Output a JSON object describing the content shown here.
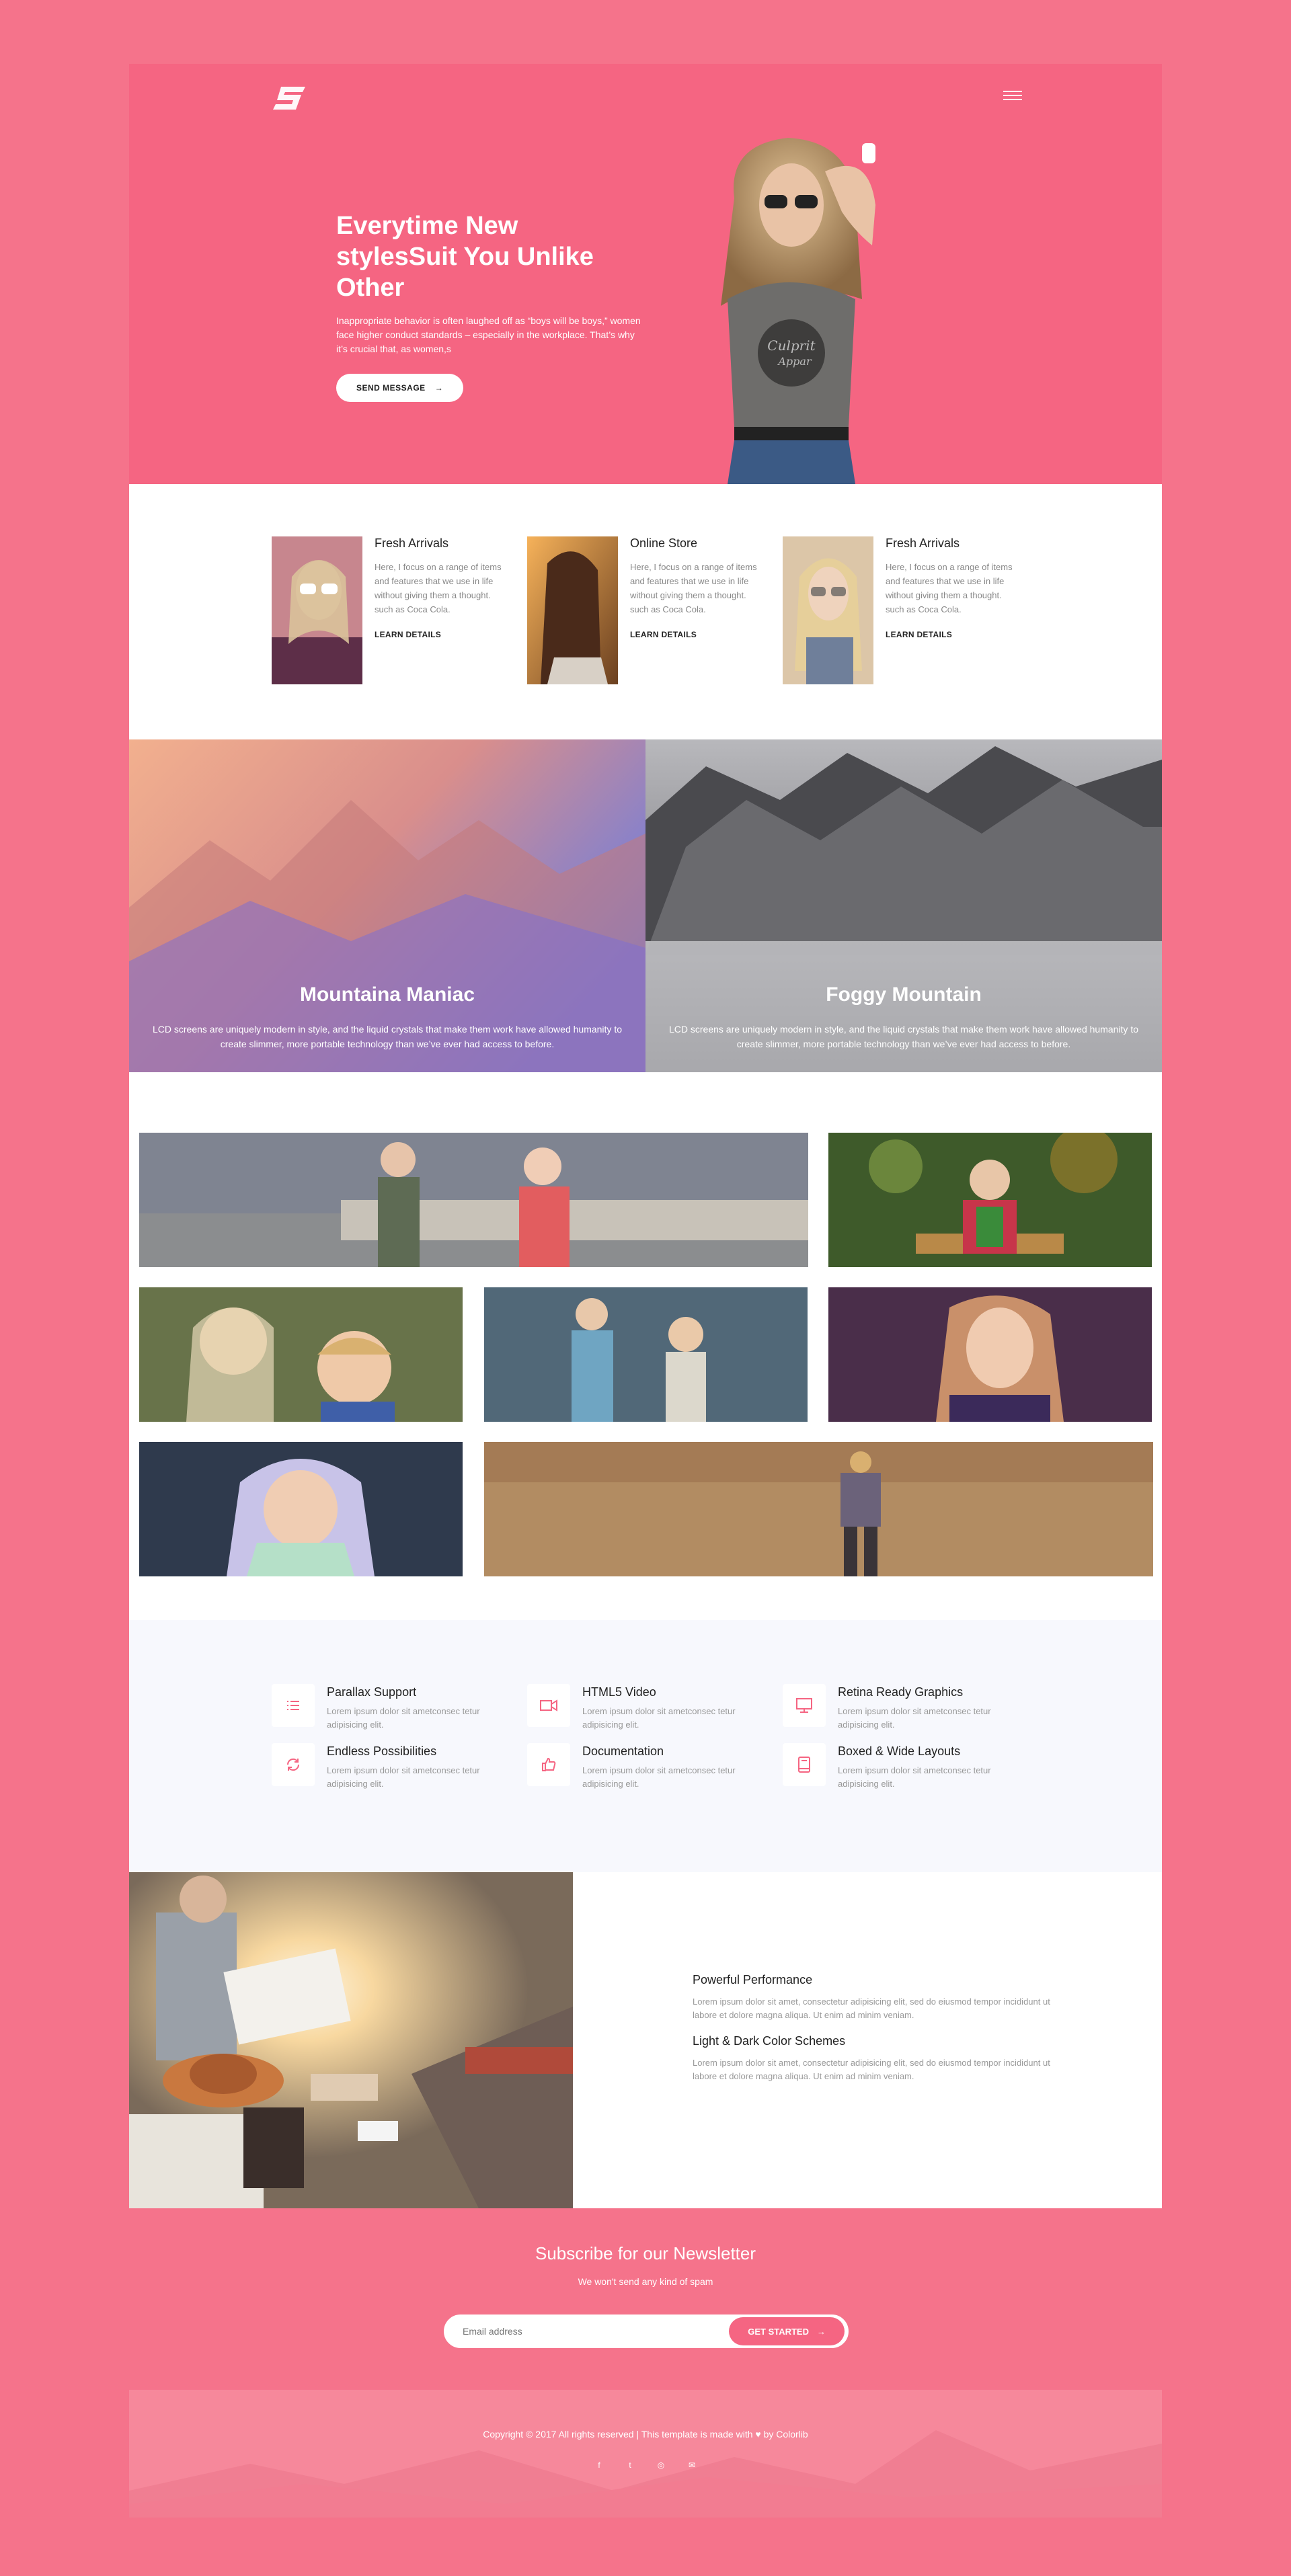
{
  "hero": {
    "title": "Everytime New stylesSuit You Unlike Other",
    "description": "Inappropriate behavior is often laughed off as “boys will be boys,” women face higher conduct standards – especially in the workplace. That’s why it’s crucial that, as women,s",
    "button_label": "SEND MESSAGE",
    "button_icon": "arrow-right-icon",
    "menu_icon": "hamburger-icon"
  },
  "features": [
    {
      "title": "Fresh Arrivals",
      "text": "Here, I focus on a range of items and features that we use in life without giving them a thought. such as Coca Cola.",
      "link": "LEARN DETAILS"
    },
    {
      "title": "Online Store",
      "text": "Here, I focus on a range of items and features that we use in life without giving them a thought. such as Coca Cola.",
      "link": "LEARN DETAILS"
    },
    {
      "title": "Fresh Arrivals",
      "text": "Here, I focus on a range of items and features that we use in life without giving them a thought. such as Coca Cola.",
      "link": "LEARN DETAILS"
    }
  ],
  "mountains": [
    {
      "title": "Mountaina Maniac",
      "text": "LCD screens are uniquely modern in style, and the liquid crystals that make them work have allowed humanity to create slimmer, more portable technology than we’ve ever had access to before."
    },
    {
      "title": "Foggy Mountain",
      "text": "LCD screens are uniquely modern in style, and the liquid crystals that make them work have allowed humanity to create slimmer, more portable technology than we’ve ever had access to before."
    }
  ],
  "services": [
    {
      "title": "Parallax Support",
      "text": "Lorem ipsum dolor sit ametconsec tetur adipisicing elit.",
      "icon": "list-icon"
    },
    {
      "title": "HTML5 Video",
      "text": "Lorem ipsum dolor sit ametconsec tetur adipisicing elit.",
      "icon": "video-camera-icon"
    },
    {
      "title": "Retina Ready Graphics",
      "text": "Lorem ipsum dolor sit ametconsec tetur adipisicing elit.",
      "icon": "monitor-icon"
    },
    {
      "title": "Endless Possibilities",
      "text": "Lorem ipsum dolor sit ametconsec tetur adipisicing elit.",
      "icon": "refresh-icon"
    },
    {
      "title": "Documentation",
      "text": "Lorem ipsum dolor sit ametconsec tetur adipisicing elit.",
      "icon": "thumbs-up-icon"
    },
    {
      "title": "Boxed & Wide Layouts",
      "text": "Lorem ipsum dolor sit ametconsec tetur adipisicing elit.",
      "icon": "book-icon"
    }
  ],
  "performance": {
    "title1": "Powerful Performance",
    "text1": "Lorem ipsum dolor sit amet, consectetur adipisicing elit, sed do eiusmod tempor incididunt ut labore et dolore magna aliqua. Ut enim ad minim veniam.",
    "title2": "Light & Dark Color Schemes",
    "text2": "Lorem ipsum dolor sit amet, consectetur adipisicing elit, sed do eiusmod tempor incididunt ut labore et dolore magna aliqua. Ut enim ad minim veniam."
  },
  "newsletter": {
    "title": "Subscribe for our Newsletter",
    "subtitle": "We won't send any kind of spam",
    "placeholder": "Email address",
    "button_label": "GET STARTED"
  },
  "footer": {
    "copyright": "Copyright © 2017 All rights reserved | This template is made with ♥ by Colorlib",
    "socials": [
      "f",
      "t",
      "◎",
      "✉"
    ]
  },
  "colors": {
    "brand": "#f56582",
    "page_bg": "#f5738b"
  }
}
